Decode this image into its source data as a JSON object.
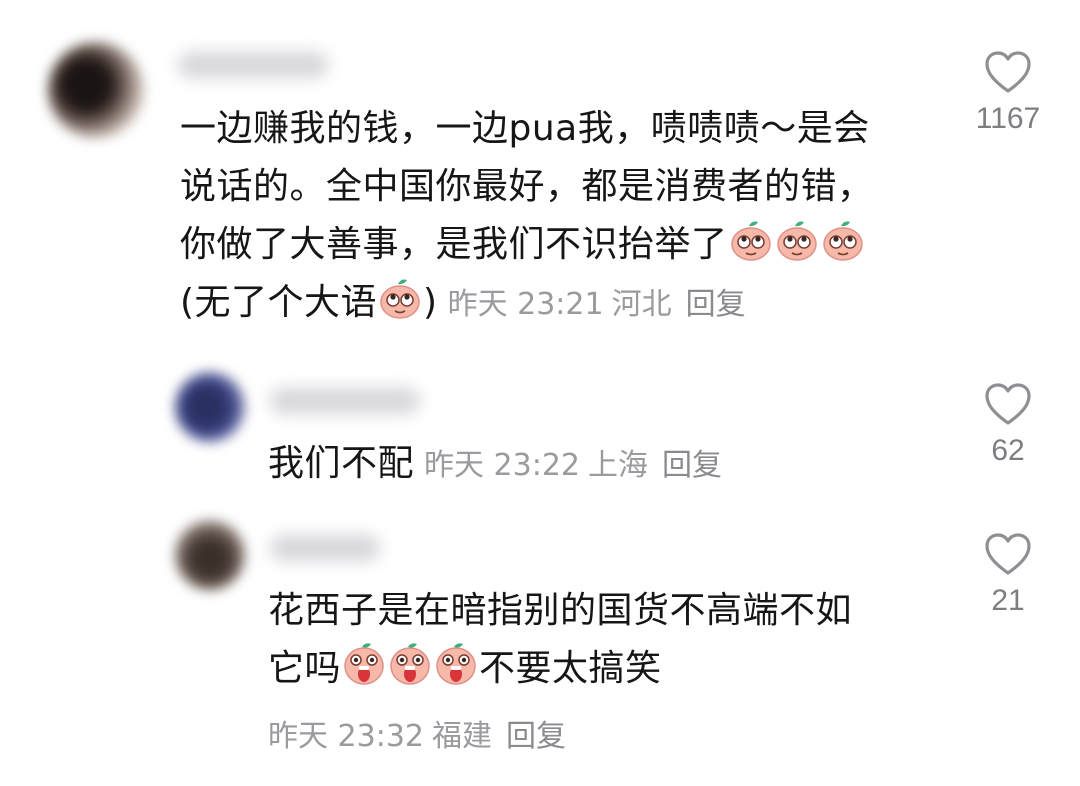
{
  "comments": [
    {
      "text_lines": [
        "一边赚我的钱，一边pua我，啧啧啧～是会",
        "说话的。全中国你最好，都是消费者的错，",
        "你做了大善事，是我们不识抬举了"
      ],
      "text_last": "(无了个大语",
      "text_close": ")",
      "emoji_line3": "eye-roll-emoji",
      "time": "昨天 23:21",
      "location": "河北",
      "reply_label": "回复",
      "like_count": "1167",
      "like_icon": "heart-outline-icon"
    },
    {
      "text": "我们不配",
      "time": "昨天 23:22",
      "location": "上海",
      "reply_label": "回复",
      "like_count": "62",
      "like_icon": "heart-outline-icon"
    },
    {
      "text_line1": "花西子是在暗指别的国货不高端不如",
      "text_line2_a": "它吗",
      "text_line2_b": "不要太搞笑",
      "emoji_line2": "crying-emoji",
      "time": "昨天 23:32",
      "location": "福建",
      "reply_label": "回复",
      "like_count": "21",
      "like_icon": "heart-outline-icon"
    }
  ],
  "colors": {
    "text": "#161616",
    "meta": "#9a9a9f",
    "count": "#7d7d82",
    "emoji_face": "#f4b6a8",
    "emoji_leaf": "#3fae7a"
  }
}
